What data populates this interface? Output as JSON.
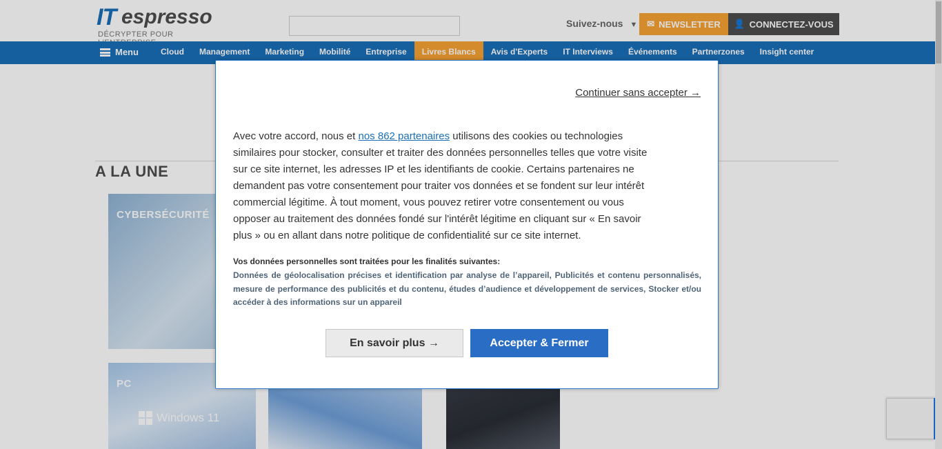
{
  "site": {
    "logo": {
      "it": "IT",
      "espresso": "espresso",
      "tagline": "DÉCRYPTER POUR L'ENTREPRISE"
    },
    "search": {
      "placeholder": ""
    },
    "follow_label": "Suivez-nous",
    "newsletter_label": "NEWSLETTER",
    "login_label": "CONNECTEZ-VOUS",
    "menu_label": "Menu",
    "nav_items": [
      "Cloud",
      "Management",
      "Marketing",
      "Mobilité",
      "Entreprise",
      "Livres Blancs",
      "Avis d'Experts",
      "IT Interviews",
      "Événements",
      "Partnerzones",
      "Insight center"
    ],
    "section_title": "A LA UNE",
    "cards": [
      {
        "category": "CYBERSÉCURITÉ"
      },
      {
        "category": "PC",
        "caption": "Windows 11"
      }
    ],
    "colors": {
      "brand_blue": "#1a6fb8",
      "newsletter_orange": "#f7a233",
      "dark_gray": "#4d4d4d"
    }
  },
  "dialog": {
    "skip_link": "Continuer sans accepter →",
    "text_before_link": "Avec votre accord, nous et ",
    "partners_link": "nos 862 partenaires",
    "text_after_link": " utilisons des cookies ou technologies similaires pour stocker, consulter et traiter des données personnelles telles que votre visite sur ce site internet, les adresses IP et les identifiants de cookie. Certains partenaires ne demandent pas votre consentement pour traiter vos données et se fondent sur leur intérêt commercial légitime. À tout moment, vous pouvez retirer votre consentement ou vous opposer au traitement des données fondé sur l'intérêt légitime en cliquant sur « En savoir plus » ou en allant dans notre politique de confidentialité sur ce site internet.",
    "purposes_title": "Vos données personnelles sont traitées pour les finalités suivantes:",
    "purposes_list": "Données de géolocalisation précises et identification par analyse de l’appareil, Publicités et contenu personnalisés, mesure de performance des publicités et du contenu, études d’audience et développement de services, Stocker et/ou accéder à des informations sur un appareil",
    "learn_more_label": "En savoir plus →",
    "accept_label": "Accepter & Fermer",
    "colors": {
      "accept_button": "#2a6dc4",
      "border": "#2a7bd0",
      "link": "#1a6fb8"
    }
  }
}
